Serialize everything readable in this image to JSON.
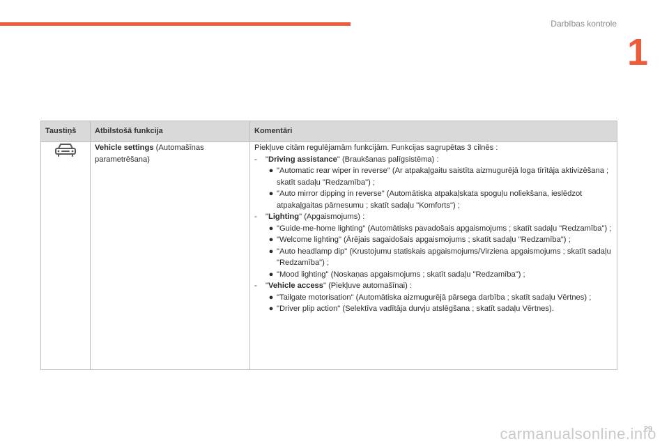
{
  "header": {
    "section_title": "Darbības kontrole",
    "chapter_number": "1"
  },
  "table": {
    "columns": [
      "Taustiņš",
      "Atbilstošā funkcija",
      "Komentāri"
    ],
    "row": {
      "key_icon": "car-icon",
      "function_title": "Vehicle settings",
      "function_subtitle": " (Automašīnas parametrēšana)",
      "comment_intro": "Piekļuve citām regulējamām funkcijām. Funkcijas sagrupētas 3 cilnēs :",
      "groups": [
        {
          "dash": "-",
          "quote_open": "\"",
          "name": "Driving assistance",
          "desc": "\" (Braukšanas palīgsistēma) :",
          "items": [
            "\"Automatic rear wiper in reverse\" (Ar atpakaļgaitu saistīta aizmugurējā loga tīrītāja aktivizēšana ; skatīt sadaļu \"Redzamība\") ;",
            "\"Auto mirror dipping in reverse\" (Automātiska atpakaļskata spoguļu noliekšana, ieslēdzot atpakaļgaitas pārnesumu ; skatīt sadaļu \"Komforts\") ;"
          ]
        },
        {
          "dash": "-",
          "quote_open": "\"",
          "name": "Lighting",
          "desc": "\" (Apgaismojums) :",
          "items": [
            "\"Guide-me-home lighting\" (Automātisks pavadošais apgaismojums ; skatīt sadaļu \"Redzamība\") ;",
            "\"Welcome lighting\" (Ārējais sagaidošais apgaismojums ; skatīt sadaļu \"Redzamība\") ;",
            "\"Auto headlamp dip\" (Krustojumu statiskais apgaismojums/Virziena apgaismojums ; skatīt sadaļu \"Redzamība\") ;",
            "\"Mood lighting\" (Noskaņas apgaismojums ; skatīt sadaļu \"Redzamība\") ;"
          ]
        },
        {
          "dash": "-",
          "quote_open": "\"",
          "name": "Vehicle access",
          "desc": "\" (Piekļuve automašīnai) :",
          "items": [
            "\"Tailgate motorisation\" (Automātiska aizmugurējā pārsega darbība ; skatīt sadaļu Vērtnes) ;",
            "\"Driver plip action\" (Selektīva vadītāja durvju atslēgšana ; skatīt sadaļu Vērtnes)."
          ]
        }
      ]
    }
  },
  "footer": {
    "page_number": "29",
    "watermark": "carmanualsonline.info"
  },
  "colors": {
    "accent": "#ee5a3a",
    "header_fill": "#d9d9d9",
    "border": "#bdbdbd"
  },
  "bullet_symbol": "●"
}
